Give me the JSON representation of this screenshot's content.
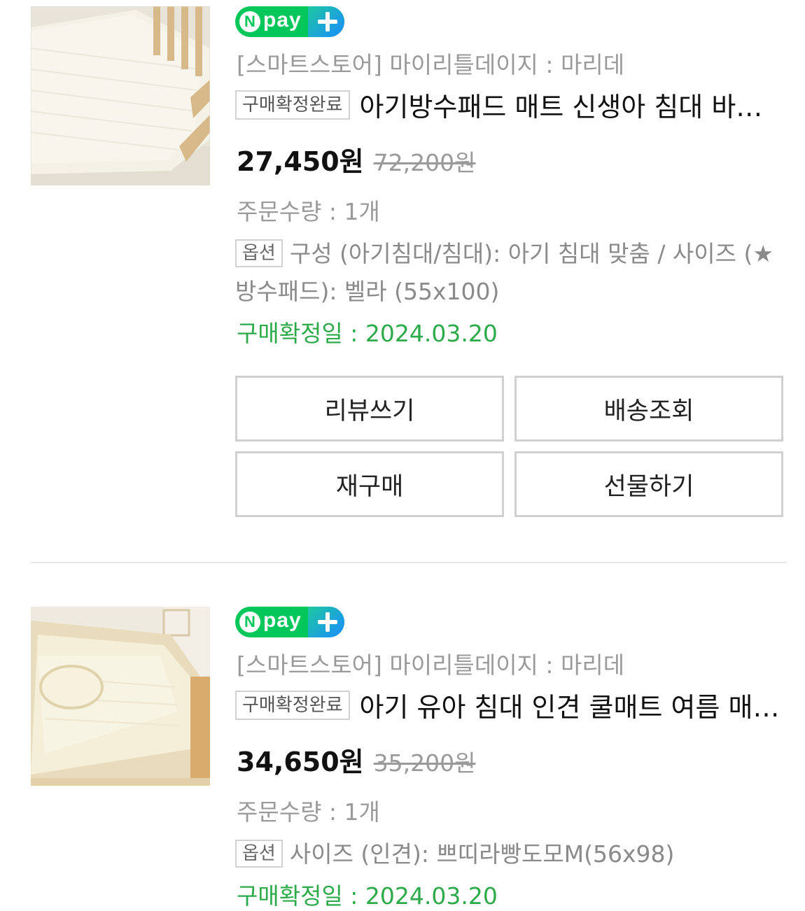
{
  "orders": [
    {
      "npay": {
        "n": "N",
        "pay": "pay"
      },
      "store": "[스마트스토어] 마이리틀데이지 : 마리데",
      "status": "구매확정완료",
      "title": "아기방수패드 매트 신생아 침대 바닥 매트리스 커버",
      "price": "27,450원",
      "original_price": "72,200원",
      "quantity": "주문수량 : 1개",
      "option_label": "옵션",
      "option_text": "구성 (아기침대/침대): 아기 침대 맞춤 / 사이즈 (★방수패드): 벨라 (55x100)",
      "confirm_date": "구매확정일 : 2024.03.20",
      "buttons": {
        "review": "리뷰쓰기",
        "tracking": "배송조회",
        "rebuy": "재구매",
        "gift": "선물하기"
      }
    },
    {
      "npay": {
        "n": "N",
        "pay": "pay"
      },
      "store": "[스마트스토어] 마이리틀데이지 : 마리데",
      "status": "구매확정완료",
      "title": "아기 유아 침대 인견 쿨매트 여름 매트리스 패드",
      "price": "34,650원",
      "original_price": "35,200원",
      "quantity": "주문수량 : 1개",
      "option_label": "옵션",
      "option_text": "사이즈 (인견): 쁘띠라빵도모M(56x98)",
      "confirm_date": "구매확정일 : 2024.03.20"
    }
  ],
  "colors": {
    "npay_green": "#03c75a",
    "confirm_green": "#2daa4a",
    "muted_gray": "#9a9a9a",
    "border_gray": "#d0d0d0"
  }
}
